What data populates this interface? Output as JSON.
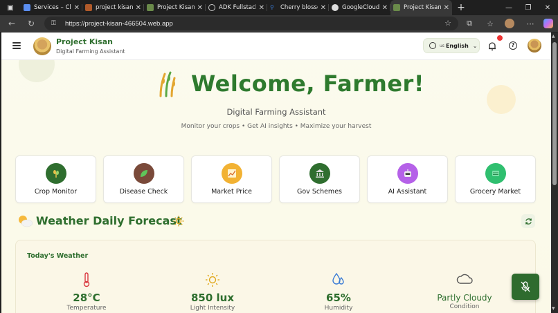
{
  "browser": {
    "tabs": [
      {
        "title": "Services – Cloud",
        "active": false,
        "fav": "#5b8def"
      },
      {
        "title": "project kisan - E",
        "active": false,
        "fav": "#b05a2a"
      },
      {
        "title": "Project Kisan - D",
        "active": false,
        "fav": "#6a8a4a"
      },
      {
        "title": "ADK Fullstack A",
        "active": false,
        "fav": "#888888"
      },
      {
        "title": "Cherry blossom",
        "active": false,
        "fav": "#3a7bd5"
      },
      {
        "title": "GoogleCloudPla",
        "active": false,
        "fav": "#dddddd"
      },
      {
        "title": "Project Kisan - D",
        "active": true,
        "fav": "#6a8a4a"
      }
    ],
    "url": "https://project-kisan-466504.web.app"
  },
  "header": {
    "brand_title": "Project Kisan",
    "brand_subtitle": "Digital Farming Assistant",
    "language_flag": "us",
    "language_label": "English"
  },
  "hero": {
    "title": "Welcome, Farmer!",
    "subtitle": "Digital Farming Assistant",
    "tagline": "Monitor your crops • Get AI insights • Maximize your harvest"
  },
  "features": [
    {
      "label": "Crop Monitor",
      "icon": "sprout-icon",
      "color": "#2f6e2f"
    },
    {
      "label": "Disease Check",
      "icon": "leaf-icon",
      "color": "#7a4a3a"
    },
    {
      "label": "Market Price",
      "icon": "chart-icon",
      "color": "#f2b233"
    },
    {
      "label": "Gov Schemes",
      "icon": "bank-icon",
      "color": "#2f6e2f"
    },
    {
      "label": "AI Assistant",
      "icon": "robot-icon",
      "color": "#b561e8"
    },
    {
      "label": "Grocery Market",
      "icon": "cart-icon",
      "color": "#2fbf6f"
    }
  ],
  "weather": {
    "section_title": "Weather Daily Forecast",
    "today_label": "Today's Weather",
    "temperature": {
      "value": "28°C",
      "caption": "Temperature"
    },
    "light": {
      "value": "850 lux",
      "caption": "Light Intensity"
    },
    "humidity": {
      "value": "65%",
      "caption": "Humidity"
    },
    "condition": {
      "value": "Partly Cloudy",
      "caption": "Condition"
    }
  }
}
